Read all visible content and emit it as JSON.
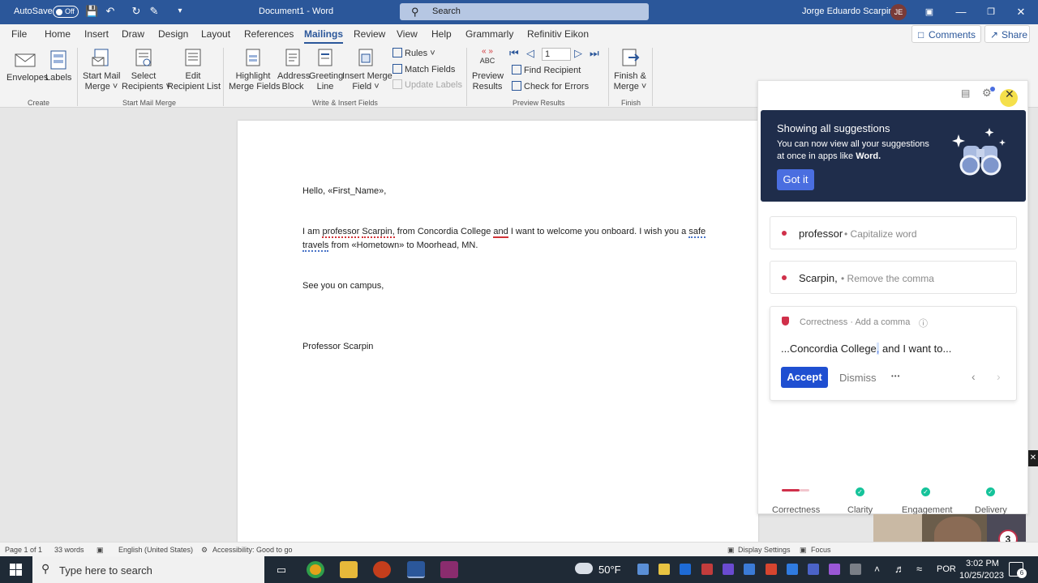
{
  "window": {
    "autosave_label": "AutoSave",
    "autosave_state": "Off",
    "title": "Document1  -  Word",
    "search_placeholder": "Search",
    "user_name": "Jorge Eduardo Scarpin",
    "user_initials": "JE"
  },
  "tabs": [
    "File",
    "Home",
    "Insert",
    "Draw",
    "Design",
    "Layout",
    "References",
    "Mailings",
    "Review",
    "View",
    "Help",
    "Grammarly",
    "Refinitiv Eikon"
  ],
  "active_tab": "Mailings",
  "header_buttons": {
    "comments": "Comments",
    "share": "Share"
  },
  "ribbon": {
    "create": {
      "envelopes": "Envelopes",
      "labels": "Labels",
      "group": "Create"
    },
    "start_mail_merge": {
      "start_l1": "Start Mail",
      "start_l2": "Merge",
      "select_l1": "Select",
      "select_l2": "Recipients",
      "edit_l1": "Edit",
      "edit_l2": "Recipient List",
      "group": "Start Mail Merge"
    },
    "write_insert": {
      "highlight_l1": "Highlight",
      "highlight_l2": "Merge Fields",
      "address_l1": "Address",
      "address_l2": "Block",
      "greeting_l1": "Greeting",
      "greeting_l2": "Line",
      "insert_l1": "Insert Merge",
      "insert_l2": "Field",
      "rules": "Rules",
      "match_fields": "Match Fields",
      "update_labels": "Update Labels",
      "group": "Write & Insert Fields"
    },
    "preview": {
      "abc": "ABC",
      "preview_l1": "Preview",
      "preview_l2": "Results",
      "record": "1",
      "find_recipient": "Find Recipient",
      "check_errors": "Check for Errors",
      "group": "Preview Results"
    },
    "finish": {
      "l1": "Finish &",
      "l2": "Merge",
      "group": "Finish"
    }
  },
  "document": {
    "greeting_hello": "Hello, ",
    "greeting_field": "«First_Name»,",
    "p1_a": "I am ",
    "p1_professor": "professor",
    "p1_b": " ",
    "p1_scarpin": "Scarpin,",
    "p1_c": " from Concordia College ",
    "p1_and": "and",
    "p1_d": " I want to welcome you onboard. I wish you a ",
    "p1_safe": "safe",
    "p2_travels": "travels",
    "p2_rest": " from «Hometown» to Moorhead, MN.",
    "closing": "See you on campus,",
    "signature": "Professor Scarpin"
  },
  "grammarly": {
    "promo_title": "Showing all suggestions",
    "promo_text_a": "You can now view all your suggestions at once in apps like ",
    "promo_text_bold": "Word.",
    "promo_button": "Got it",
    "card1_word": "professor",
    "card1_suggestion": "• Capitalize word",
    "card2_word": "Scarpin,",
    "card2_suggestion": "• Remove the comma",
    "card3_category": "Correctness · Add a comma",
    "card3_text_a": "...Concordia College",
    "card3_text_comma": ",",
    "card3_text_b": " and I want to...",
    "accept": "Accept",
    "dismiss": "Dismiss",
    "more": "•••",
    "nav": [
      "Correctness",
      "Clarity",
      "Engagement",
      "Delivery"
    ],
    "badge_count": "3"
  },
  "status": {
    "page": "Page 1 of 1",
    "words": "33 words",
    "language": "English (United States)",
    "accessibility": "Accessibility: Good to go",
    "display_settings": "Display Settings",
    "focus": "Focus"
  },
  "taskbar": {
    "search_placeholder": "Type here to search",
    "weather": "50°F",
    "lang": "POR",
    "time": "3:02 PM",
    "date": "10/25/2023",
    "notif_count": "6"
  },
  "colors": {
    "word_blue": "#2b579a",
    "grammarly_red": "#d0304a",
    "grammarly_green": "#15c39a",
    "accept_blue": "#1f4fd1"
  }
}
